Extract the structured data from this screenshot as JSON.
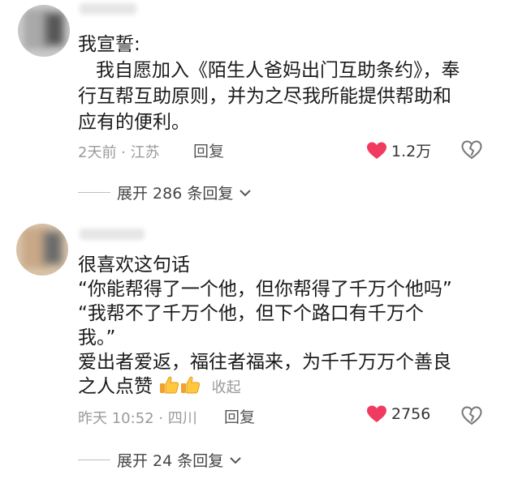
{
  "comment1": {
    "line1": "我宣誓:",
    "line2": "我自愿加入《陌生人爸妈出门互助条约》，奉",
    "line3": "行互帮互助原则，并为之尽我所能提供帮助和",
    "line4": "应有的便利。",
    "meta": "2天前 · 江苏",
    "reply": "回复",
    "likes": "1.2万",
    "expand": "展开 286 条回复"
  },
  "comment2": {
    "line1": "很喜欢这句话",
    "line2": "“你能帮得了一个他，但你帮得了千万个他吗”",
    "line3": "“我帮不了千万个他，但下个路口有千万个",
    "line4": "我。”",
    "line5": "爱出者爱返，福往者福来，为千千万万个善良",
    "line6": "之人点赞",
    "collapse": "收起",
    "meta": "昨天 10:52 · 四川",
    "reply": "回复",
    "likes": "2756",
    "expand": "展开 24 条回复"
  },
  "colors": {
    "heart": "#f03a5f",
    "meta": "#9a9a9a"
  },
  "icons": [
    "heart-icon",
    "dislike-heart-icon",
    "chevron-down-icon",
    "thumbs-up-icon"
  ]
}
